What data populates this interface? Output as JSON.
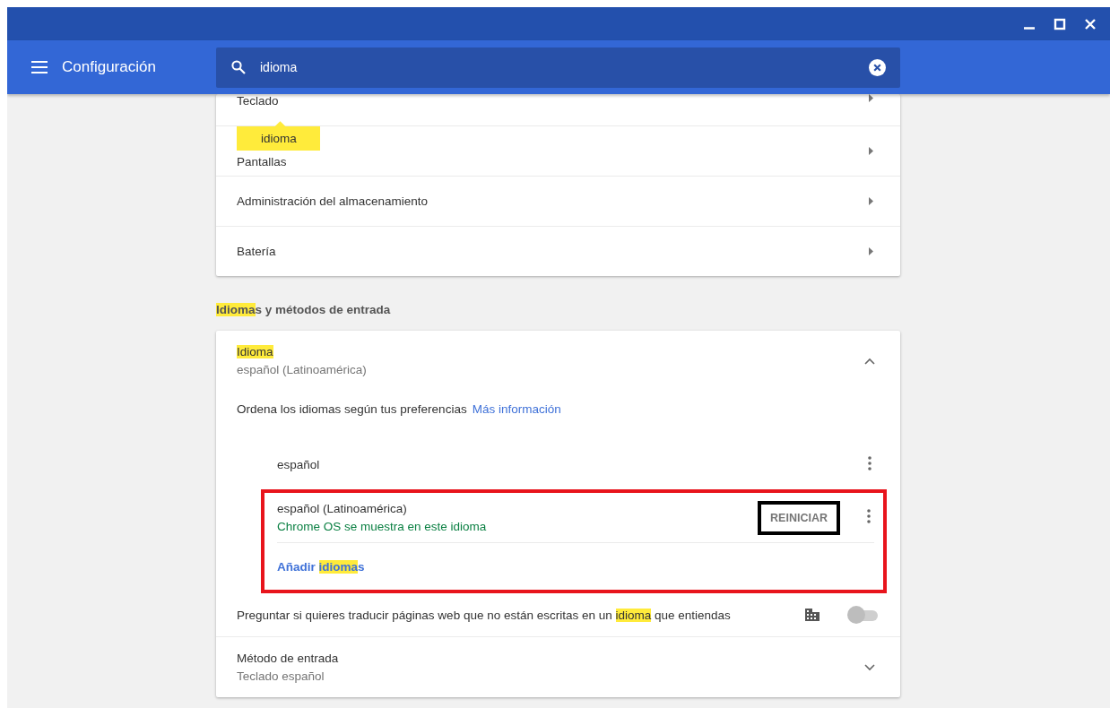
{
  "header": {
    "title": "Configuración",
    "search": {
      "value": "idioma"
    }
  },
  "device_card": {
    "rows": [
      {
        "label": "Teclado",
        "cut": true
      },
      {
        "label": "Pantallas",
        "cut": false
      },
      {
        "label": "Administración del almacenamiento",
        "cut": false
      },
      {
        "label": "Batería",
        "cut": false
      }
    ]
  },
  "tooltip": {
    "text": "idioma"
  },
  "languages_section": {
    "heading": [
      {
        "text": "Idioma",
        "highlight": true
      },
      {
        "text": "s y métodos de entrada",
        "highlight": false
      }
    ],
    "language": {
      "title": [
        {
          "text": "Idioma",
          "highlight": true
        }
      ],
      "value": "español (Latinoamérica)",
      "expanded": true
    },
    "order_text": "Ordena los idiomas según tus preferencias",
    "more_link": "Más información",
    "items": [
      {
        "name": "español",
        "framed": false
      },
      {
        "name": "español (Latinoamérica)",
        "note": "Chrome OS se muestra en este idioma",
        "action": "REINICIAR",
        "framed": true
      }
    ],
    "add_link": [
      {
        "text": "Añadir ",
        "highlight": false
      },
      {
        "text": "idioma",
        "highlight": true
      },
      {
        "text": "s",
        "highlight": false
      }
    ],
    "frame": {
      "color": "#e8141c"
    },
    "translate": {
      "label": [
        {
          "text": "Preguntar si quieres traducir páginas web que no están escritas en un ",
          "highlight": false
        },
        {
          "text": "idioma",
          "highlight": true
        },
        {
          "text": " que entiendas",
          "highlight": false
        }
      ],
      "on": false
    },
    "input_method": {
      "title": "Método de entrada",
      "value": "Teclado español",
      "expanded": false
    }
  }
}
